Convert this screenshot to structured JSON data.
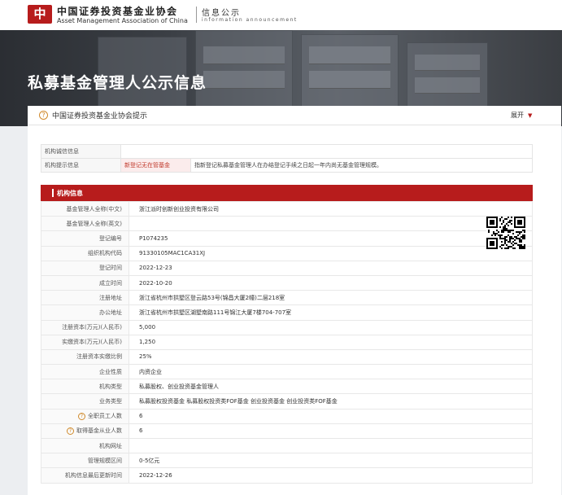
{
  "header": {
    "logo_mark": "中",
    "org_cn": "中国证券投资基金业协会",
    "org_en": "Asset Management Association of China",
    "section_cn": "信息公示",
    "section_en": "information announcement"
  },
  "banner": {
    "title": "私募基金管理人公示信息"
  },
  "notice": {
    "text": "中国证券投资基金业协会提示",
    "expand_label": "展开",
    "icon": "question-circle-icon"
  },
  "tips": [
    {
      "label": "机构诚信信息",
      "tag": "",
      "desc": ""
    },
    {
      "label": "机构提示信息",
      "tag": "新登记无在管基金",
      "desc": "指新登记私募基金管理人在办结登记手续之日起一年内尚无基金管理规模。"
    }
  ],
  "section": {
    "title": "机构信息"
  },
  "info_rows": [
    {
      "label": "基金管理人全称(中文)",
      "value": "浙江派时创新创业投资有限公司",
      "help": false
    },
    {
      "label": "基金管理人全称(英文)",
      "value": "",
      "help": false
    },
    {
      "label": "登记编号",
      "value": "P1074235",
      "help": false
    },
    {
      "label": "组织机构代码",
      "value": "91330105MAC1CA31XJ",
      "help": false
    },
    {
      "label": "登记时间",
      "value": "2022-12-23",
      "help": false
    },
    {
      "label": "成立时间",
      "value": "2022-10-20",
      "help": false
    },
    {
      "label": "注册地址",
      "value": "浙江省杭州市拱墅区登云路53号(锦昌大厦2幢)二层218室",
      "help": false
    },
    {
      "label": "办公地址",
      "value": "浙江省杭州市拱墅区湖墅南路111号锦江大厦7楼704-707室",
      "help": false
    },
    {
      "label": "注册资本(万元)(人民币)",
      "value": "5,000",
      "help": false
    },
    {
      "label": "实缴资本(万元)(人民币)",
      "value": "1,250",
      "help": false
    },
    {
      "label": "注册资本实缴比例",
      "value": "25%",
      "help": false
    },
    {
      "label": "企业性质",
      "value": "内资企业",
      "help": false
    },
    {
      "label": "机构类型",
      "value": "私募股权、创业投资基金管理人",
      "help": false
    },
    {
      "label": "业务类型",
      "value": "私募股权投资基金  私募股权投资类FOF基金  创业投资基金  创业投资类FOF基金",
      "help": false
    },
    {
      "label": "全职员工人数",
      "value": "6",
      "help": true
    },
    {
      "label": "取得基金从业人数",
      "value": "6",
      "help": true
    },
    {
      "label": "机构网址",
      "value": "",
      "help": false
    },
    {
      "label": "管理规模区间",
      "value": "0-5亿元",
      "help": false
    },
    {
      "label": "机构信息最后更新时间",
      "value": "2022-12-26",
      "help": false
    }
  ],
  "colors": {
    "brand_red": "#b71c1c",
    "warn_text": "#c0392b",
    "help_icon": "#d08a2c"
  }
}
